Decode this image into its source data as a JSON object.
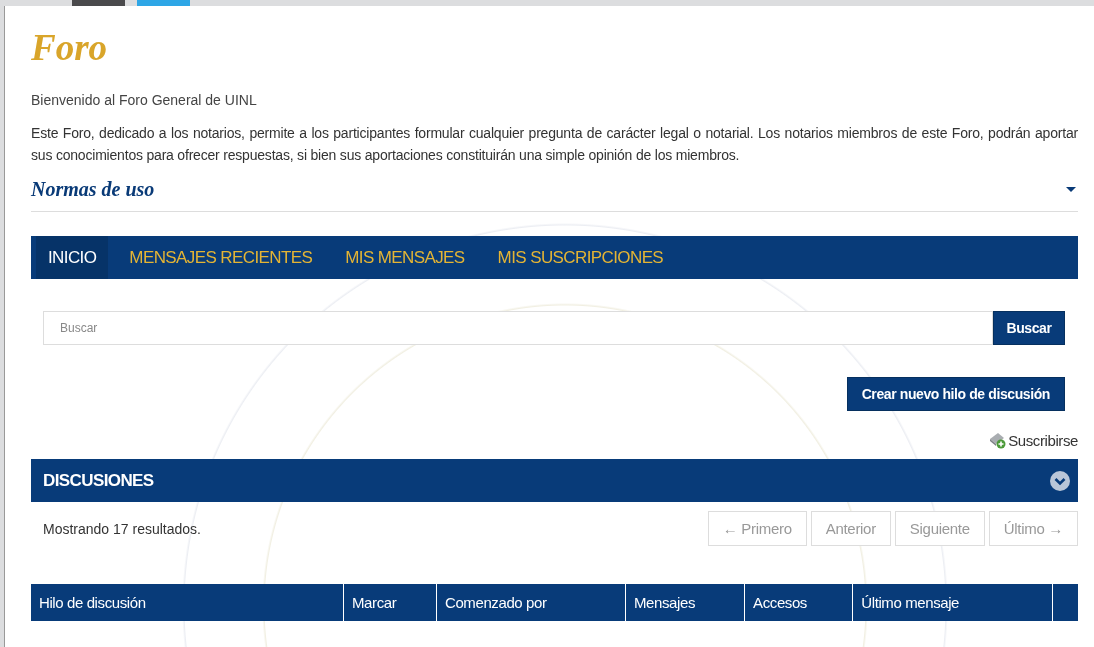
{
  "title": "Foro",
  "welcome": "Bienvenido al Foro General de UINL",
  "intro": "Este Foro, dedicado a los notarios, permite a los participantes formular cualquier pregunta de carácter legal o notarial. Los notarios miembros de este Foro, podrán aportar sus conocimientos para ofrecer respuestas, si bien sus aportaciones constituirán una simple opinión de los miembros.",
  "rules_section": {
    "title": "Normas de uso",
    "expanded": false
  },
  "tabs": [
    {
      "label": "INICIO",
      "selected": true
    },
    {
      "label": "MENSAJES RECIENTES",
      "selected": false
    },
    {
      "label": "MIS MENSAJES",
      "selected": false
    },
    {
      "label": "MIS SUSCRIPCIONES",
      "selected": false
    }
  ],
  "search": {
    "placeholder": "Buscar",
    "button": "Buscar"
  },
  "new_thread_button": "Crear nuevo hilo de discusión",
  "subscribe_link": "Suscribirse",
  "discussions": {
    "title": "DISCUSIONES",
    "expanded": true
  },
  "results_text": "Mostrando 17 resultados.",
  "pagination": [
    {
      "label": "← Primero",
      "disabled": true
    },
    {
      "label": "Anterior",
      "disabled": true
    },
    {
      "label": "Siguiente",
      "disabled": true
    },
    {
      "label": "Último →",
      "disabled": true
    }
  ],
  "table": {
    "columns": [
      "Hilo de discusión",
      "Marcar",
      "Comenzado por",
      "Mensajes",
      "Accesos",
      "Último mensaje",
      ""
    ]
  }
}
